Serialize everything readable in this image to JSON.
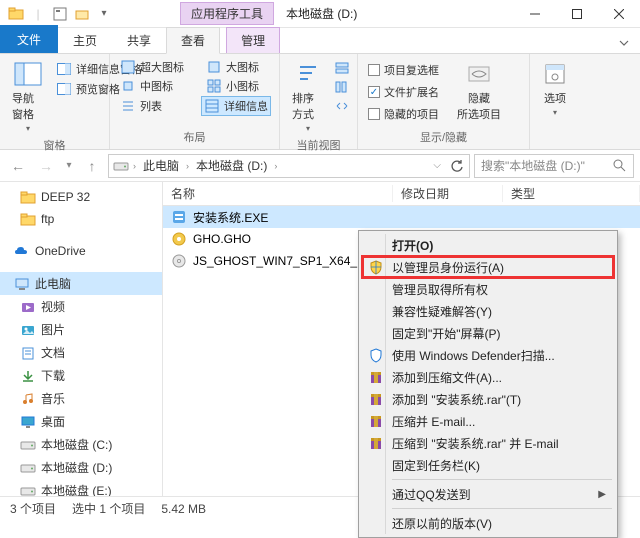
{
  "titlebar": {
    "context_tab": "应用程序工具",
    "title": "本地磁盘 (D:)"
  },
  "tabs": {
    "file": "文件",
    "home": "主页",
    "share": "共享",
    "view": "查看",
    "manage": "管理"
  },
  "ribbon": {
    "panes": {
      "nav_pane": "导航窗格",
      "preview_pane": "预览窗格",
      "detail_pane": "详细信息窗格",
      "group_label": "窗格"
    },
    "layout": {
      "extra_large": "超大图标",
      "large": "大图标",
      "medium": "中图标",
      "small": "小图标",
      "list": "列表",
      "details": "详细信息",
      "group_label": "布局"
    },
    "current_view": {
      "sort": "排序方式",
      "group_label": "当前视图"
    },
    "show_hide": {
      "checkboxes": "项目复选框",
      "extensions": "文件扩展名",
      "hidden_items": "隐藏的项目",
      "hide_selected": "隐藏\n所选项目",
      "group_label": "显示/隐藏",
      "ext_checked": "✓"
    },
    "options": "选项"
  },
  "address": {
    "this_pc": "此电脑",
    "drive": "本地磁盘 (D:)",
    "search_placeholder": "搜索\"本地磁盘 (D:)\""
  },
  "sidebar": {
    "items": [
      {
        "label": "DEEP 32"
      },
      {
        "label": "ftp"
      },
      {
        "label": "OneDrive"
      },
      {
        "label": "此电脑"
      },
      {
        "label": "视频"
      },
      {
        "label": "图片"
      },
      {
        "label": "文档"
      },
      {
        "label": "下载"
      },
      {
        "label": "音乐"
      },
      {
        "label": "桌面"
      },
      {
        "label": "本地磁盘 (C:)"
      },
      {
        "label": "本地磁盘 (D:)"
      },
      {
        "label": "本地磁盘 (E:)"
      }
    ]
  },
  "columns": {
    "name": "名称",
    "modified": "修改日期",
    "type": "类型"
  },
  "files": {
    "rows": [
      {
        "name": "安装系统.EXE"
      },
      {
        "name": "GHO.GHO"
      },
      {
        "name": "JS_GHOST_WIN7_SP1_X64_..."
      }
    ]
  },
  "context_menu": {
    "open": "打开(O)",
    "run_admin": "以管理员身份运行(A)",
    "take_ownership": "管理员取得所有权",
    "troubleshoot": "兼容性疑难解答(Y)",
    "pin_start": "固定到\"开始\"屏幕(P)",
    "defender": "使用 Windows Defender扫描...",
    "add_archive": "添加到压缩文件(A)...",
    "add_rar": "添加到 \"安装系统.rar\"(T)",
    "email_zip": "压缩并 E-mail...",
    "email_rar": "压缩到 \"安装系统.rar\" 并 E-mail",
    "pin_taskbar": "固定到任务栏(K)",
    "qq_send": "通过QQ发送到",
    "restore_prev": "还原以前的版本(V)"
  },
  "statusbar": {
    "count": "3 个项目",
    "selection": "选中 1 个项目",
    "size": "5.42 MB"
  }
}
